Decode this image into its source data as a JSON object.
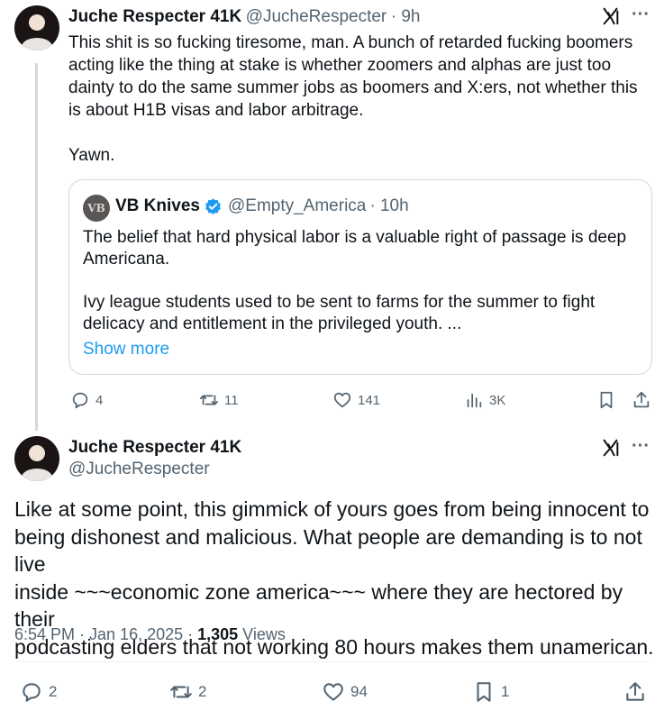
{
  "tweet1": {
    "name": "Juche Respecter 41K",
    "handle": "@JucheRespecter",
    "time": "· 9h",
    "text": "This shit is so fucking tiresome, man. A bunch of retarded fucking boomers\nacting like the thing at stake is whether zoomers and alphas are just too\ndainty to do the same summer jobs as boomers and X:ers, not whether this\nis about H1B visas and labor arbitrage.\n\nYawn.",
    "quote": {
      "avatar_text": "VB",
      "name": "VB Knives",
      "handle": "@Empty_America",
      "time": "· 10h",
      "text": "The belief that hard physical labor is a valuable right of passage is deep\nAmericana.\n\nIvy league students used to be sent to farms for the summer to fight\ndelicacy and entitlement in the privileged youth. ...",
      "show_more": "Show more"
    },
    "actions": {
      "replies": "4",
      "reposts": "11",
      "likes": "141",
      "views": "3K"
    }
  },
  "tweet2": {
    "name": "Juche Respecter 41K",
    "handle": "@JucheRespecter",
    "text": "Like at some point, this gimmick of yours goes from being innocent to\nbeing dishonest and malicious. What people are demanding is to not live\ninside ~~~economic zone america~~~ where they are hectored by their\npodcasting elders that not working 80 hours makes them unamerican.",
    "timestamp": "6:54 PM · Jan 16, 2025 · ",
    "views_count": "1,305",
    "views_label": " Views",
    "actions": {
      "replies": "2",
      "reposts": "2",
      "likes": "94",
      "bookmarks": "1"
    }
  },
  "colors": {
    "accent": "#1d9bf0",
    "muted": "#536471",
    "text": "#0f1419",
    "border": "#cfd9de"
  }
}
